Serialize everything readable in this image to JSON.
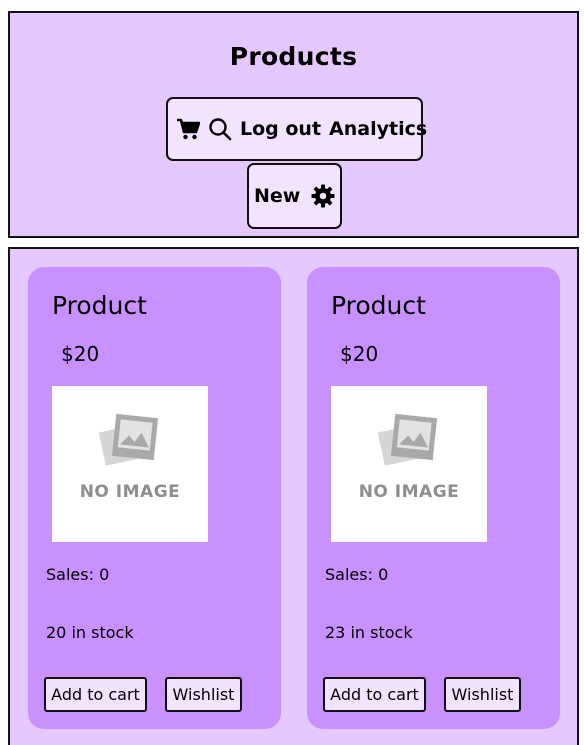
{
  "header": {
    "title": "Products",
    "buttons": {
      "logout_label": "Log out",
      "analytics_label": "Analytics",
      "new_label": "New"
    },
    "icons": [
      "cart-icon",
      "search-icon",
      "gear-icon"
    ]
  },
  "products": [
    {
      "name": "Product",
      "price": "$20",
      "image_placeholder": "NO IMAGE",
      "sales": "Sales: 0",
      "stock": "20 in stock",
      "add_to_cart_label": "Add to cart",
      "wishlist_label": "Wishlist"
    },
    {
      "name": "Product",
      "price": "$20",
      "image_placeholder": "NO IMAGE",
      "sales": "Sales: 0",
      "stock": "23 in stock",
      "add_to_cart_label": "Add to cart",
      "wishlist_label": "Wishlist"
    }
  ],
  "colors": {
    "header_bg": "#e4c8ff",
    "main_bg": "#e4c8ff",
    "card_bg": "#c990ff",
    "button_bg": "#f2e3ff",
    "placeholder_text": "#8e8e8e"
  }
}
